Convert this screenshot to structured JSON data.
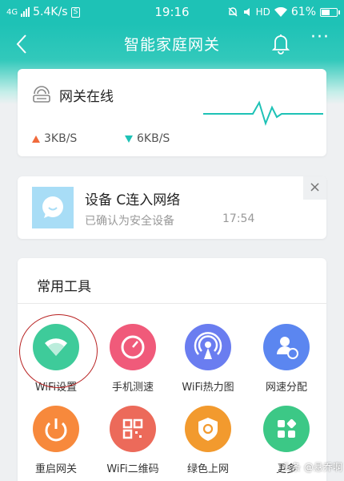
{
  "status_bar": {
    "network": "4G",
    "speed": "5.4K/s",
    "box_badge": "S",
    "time": "19:16",
    "lte": "HD",
    "battery": "61%",
    "battery_level": 0.61
  },
  "header": {
    "title": "智能家庭网关"
  },
  "gateway_card": {
    "status": "网关在线",
    "upload": "3KB/S",
    "download": "6KB/S",
    "colors": {
      "upload": "#f06a3c",
      "download": "#1ec2b6"
    }
  },
  "notice": {
    "title": "设备        C连入网络",
    "subtitle": "已确认为安全设备",
    "time": "17:54",
    "close": "×"
  },
  "tools": {
    "heading": "常用工具",
    "items": [
      {
        "label": "WiFi设置",
        "icon": "wifi-icon",
        "color": "#3ecb9a"
      },
      {
        "label": "手机测速",
        "icon": "speedometer-icon",
        "color": "#f05a7a"
      },
      {
        "label": "WiFi热力图",
        "icon": "signal-tower-icon",
        "color": "#6a7df0"
      },
      {
        "label": "网速分配",
        "icon": "user-allocate-icon",
        "color": "#5b86f0"
      },
      {
        "label": "重启网关",
        "icon": "power-icon",
        "color": "#f7893c"
      },
      {
        "label": "WiFi二维码",
        "icon": "qr-code-icon",
        "color": "#ec6a5a"
      },
      {
        "label": "绿色上网",
        "icon": "shield-icon",
        "color": "#f29a2e"
      },
      {
        "label": "更多",
        "icon": "grid-icon",
        "color": "#3cc886"
      }
    ]
  },
  "watermark": "头条 @悬乔啊"
}
